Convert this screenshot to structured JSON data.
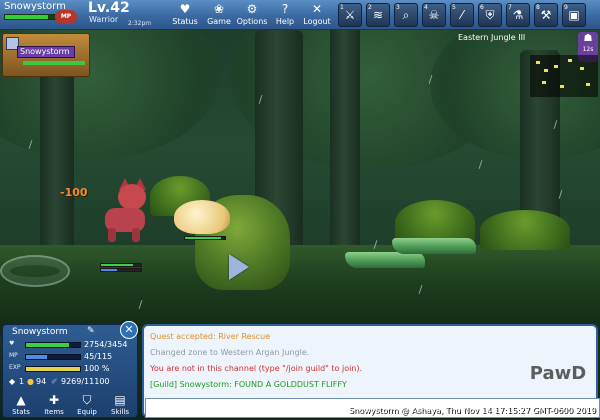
{
  "topbar": {
    "player_name": "Snowystorm",
    "mp_label": "MP",
    "level": "Lv.42",
    "class": "Warrior",
    "clock": "2:32pm",
    "menu": [
      {
        "label": "Status",
        "icon": "heart-icon"
      },
      {
        "label": "Game",
        "icon": "paw-icon"
      },
      {
        "label": "Options",
        "icon": "gear-icon"
      },
      {
        "label": "Help",
        "icon": "help-icon"
      },
      {
        "label": "Logout",
        "icon": "close-icon"
      }
    ],
    "skills": [
      {
        "key": "1",
        "icon": "sword-icon"
      },
      {
        "key": "2",
        "icon": "claw-icon"
      },
      {
        "key": "3",
        "icon": "search-icon"
      },
      {
        "key": "4",
        "icon": "skull-icon"
      },
      {
        "key": "5",
        "icon": "slash-icon"
      },
      {
        "key": "6",
        "icon": "shield-icon"
      },
      {
        "key": "7",
        "icon": "potion-icon"
      },
      {
        "key": "8",
        "icon": "axe-icon"
      },
      {
        "key": "9",
        "icon": "chest-icon"
      }
    ]
  },
  "party": {
    "member_name": "Snowystorm",
    "hp_fraction": 0.86
  },
  "zone": {
    "name": "Eastern Jungle III",
    "tag_label": "12s"
  },
  "damage_text": "-100",
  "status": {
    "name": "Snowystorm",
    "rows": [
      {
        "label": "HP",
        "value": "2754/3454",
        "fraction": 0.8,
        "color": "#3fd042"
      },
      {
        "label": "MP",
        "value": "45/115",
        "fraction": 0.39,
        "color": "#4a8fe6"
      },
      {
        "label": "EXP",
        "value": "100 %",
        "fraction": 1.0,
        "color": "#e6d24a"
      }
    ],
    "currency": {
      "crystals": "1",
      "gold": "94",
      "glory": "9269/11100"
    },
    "tabs": [
      {
        "label": "Stats",
        "icon": "stats-icon"
      },
      {
        "label": "Items",
        "icon": "items-icon"
      },
      {
        "label": "Equip",
        "icon": "equip-icon"
      },
      {
        "label": "Skills",
        "icon": "skills-icon"
      }
    ]
  },
  "chat": {
    "lines": [
      {
        "text": "Quest accepted: River Rescue",
        "color": "#d9902d"
      },
      {
        "text": "Changed zone to Western Argan Jungle.",
        "color": "#8d9aaa"
      },
      {
        "text": "You are not in this channel (type \"/join guild\" to join).",
        "color": "#d72f2f"
      },
      {
        "text": "[Guild] Snowystorm: FOUND A GOLDDUST FLIFFY",
        "color": "#1f9a1f"
      }
    ],
    "input_value": "",
    "footer": "Snowystorm @ Ashaya, Thu Nov 14 17:15:27 GMT-0600 2019",
    "logo_text": "PawD"
  }
}
